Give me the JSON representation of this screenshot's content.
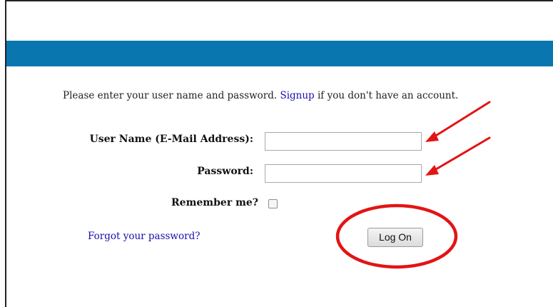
{
  "intro": {
    "before_link": "Please enter your user name and password. ",
    "signup_link": "Signup",
    "after_link": " if you don't have an account."
  },
  "form": {
    "username_label": "User Name (E-Mail Address):",
    "username_value": "",
    "password_label": "Password:",
    "password_value": "",
    "remember_label": "Remember me?",
    "remember_checked": false,
    "forgot_link": "Forgot your password?",
    "logon_button": "Log On"
  },
  "annotations": {
    "color": "#e31414",
    "arrow_icon": "red-arrow-icon",
    "circle_icon": "red-circle-icon"
  },
  "theme": {
    "header_color": "#0a76b0",
    "link_color": "#1a0dab"
  }
}
